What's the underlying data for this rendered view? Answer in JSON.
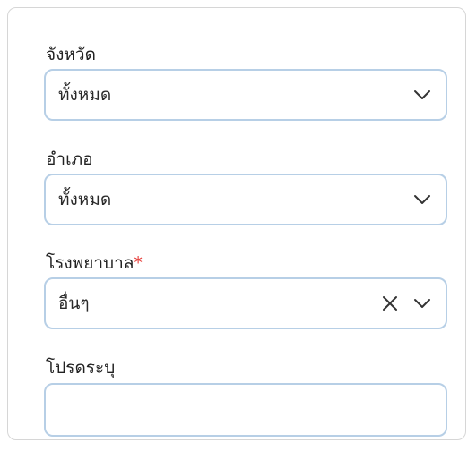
{
  "form": {
    "province": {
      "label": "จังหวัด",
      "value": "ทั้งหมด"
    },
    "district": {
      "label": "อำเภอ",
      "value": "ทั้งหมด"
    },
    "hospital": {
      "label": "โรงพยาบาล",
      "required_mark": "*",
      "value": "อื่นๆ"
    },
    "specify": {
      "label": "โปรดระบุ",
      "value": ""
    }
  },
  "icons": {
    "chevron": "chevron-down-icon",
    "clear": "close-icon"
  },
  "colors": {
    "field_border": "#b7cfe6",
    "required": "#e53935",
    "icon": "#333333"
  }
}
